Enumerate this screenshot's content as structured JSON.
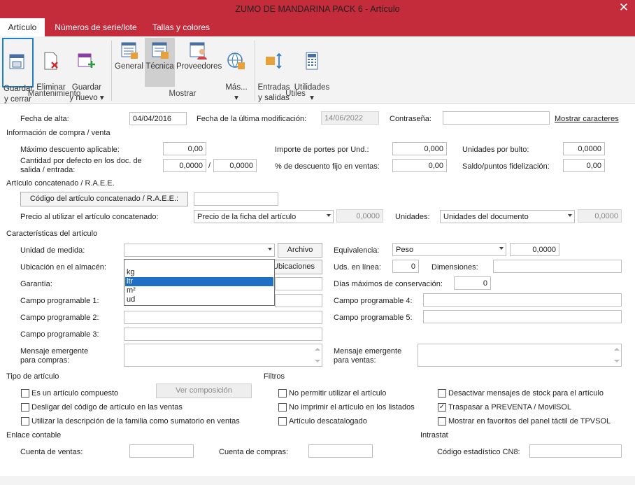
{
  "window": {
    "title": "ZUMO DE MANDARINA PACK 6  -  Artículo",
    "close": "✕"
  },
  "tabs": [
    "Artículo",
    "Números de serie/lote",
    "Tallas y colores"
  ],
  "ribbon": {
    "buttons": {
      "guardar_cerrar": "Guardar\ny cerrar",
      "eliminar": "Eliminar",
      "guardar_nuevo": "Guardar\ny nuevo ▾",
      "general": "General",
      "tecnica": "Técnica",
      "proveedores": "Proveedores",
      "mas": "Más...\n▾",
      "entradas": "Entradas\ny salidas",
      "utilidades": "Utilidades\n▾"
    },
    "groups": {
      "mantenimiento": "Mantenimiento",
      "mostrar": "Mostrar",
      "utiles": "Útiles"
    }
  },
  "header": {
    "fecha_alta_label": "Fecha de alta:",
    "fecha_alta": "04/04/2016",
    "fecha_mod_label": "Fecha de la última modificación:",
    "fecha_mod": "14/06/2022",
    "contrasena_label": "Contraseña:",
    "mostrar_caracteres": "Mostrar caracteres"
  },
  "compra": {
    "section": "Información de compra / venta",
    "max_desc_label": "Máximo descuento aplicable:",
    "max_desc": "0,00",
    "cantidad_label": "Cantidad por defecto en los doc. de\nsalida / entrada:",
    "cant_salida": "0,0000",
    "slash": "/",
    "cant_entrada": "0,0000",
    "portes_label": "Importe de portes por Und.:",
    "portes": "0,000",
    "desc_fijo_label": "% de descuento fijo en ventas:",
    "desc_fijo": "0,00",
    "unid_bulto_label": "Unidades por bulto:",
    "unid_bulto": "0,0000",
    "saldo_label": "Saldo/puntos fidelización:",
    "saldo": "0,00"
  },
  "concatenado": {
    "section": "Artículo concatenado / R.A.E.E.",
    "codigo_btn": "Código del artículo concatenado / R.A.E.E.:",
    "codigo": "",
    "precio_label": "Precio al utilizar el artículo concatenado:",
    "precio_sel": "Precio de la ficha del artículo",
    "precio_val": "0,0000",
    "unidades_label": "Unidades:",
    "unidades_sel": "Unidades del documento",
    "unidades_val": "0,0000"
  },
  "caracteristicas": {
    "section": "Características del artículo",
    "unidad_label": "Unidad de medida:",
    "unidad": "",
    "archivo_btn": "Archivo",
    "ubicacion_label": "Ubicación en el almacén:",
    "ubicaciones_btn": "Ubicaciones",
    "garantia_label": "Garantía:",
    "campo1_label": "Campo programable 1:",
    "campo2_label": "Campo programable 2:",
    "campo3_label": "Campo programable 3:",
    "msg_compras_label": "Mensaje emergente\npara compras:",
    "equivalencia_label": "Equivalencia:",
    "equivalencia_sel": "Peso",
    "equivalencia_val": "0,0000",
    "uds_linea_label": "Uds. en línea:",
    "uds_linea": "0",
    "dimensiones_label": "Dimensiones:",
    "dias_label": "Días máximos de conservación:",
    "dias": "0",
    "campo4_label": "Campo programable 4:",
    "campo5_label": "Campo programable 5:",
    "msg_ventas_label": "Mensaje emergente\npara ventas:"
  },
  "dropdown": {
    "options": [
      "kg",
      "ltr",
      "m²",
      "ud"
    ],
    "highlighted": "ltr"
  },
  "tipo": {
    "section": "Tipo de artículo",
    "compuesto": "Es un artículo compuesto",
    "ver_composicion": "Ver composición",
    "desligar": "Desligar del código de artículo en las ventas",
    "utilizar_desc": "Utilizar la descripción de la familia como sumatorio en ventas"
  },
  "filtros": {
    "section": "Filtros",
    "no_permitir": "No permitir utilizar el artículo",
    "no_imprimir": "No imprimir el artículo en los listados",
    "descatalogado": "Artículo descatalogado",
    "desactivar_stock": "Desactivar mensajes de stock para el artículo",
    "traspasar": "Traspasar a PREVENTA / MovilSOL",
    "traspasar_checked": "✓",
    "mostrar_fav": "Mostrar en favoritos del panel táctil de TPVSOL"
  },
  "contable": {
    "section": "Enlace contable",
    "ventas_label": "Cuenta de ventas:",
    "compras_label": "Cuenta de compras:"
  },
  "intrastat": {
    "section": "Intrastat",
    "cn8_label": "Código estadístico CN8:"
  },
  "colors": {
    "accent": "#c42b3b",
    "selection": "#1f6fc5"
  }
}
